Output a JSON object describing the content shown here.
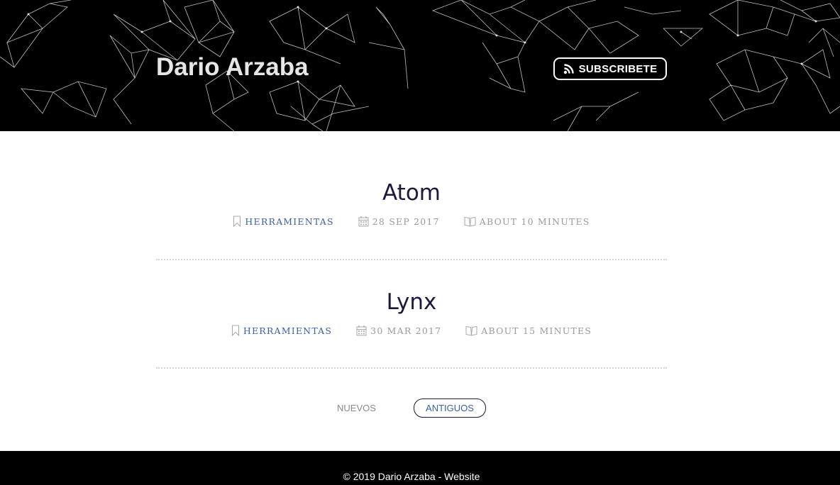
{
  "header": {
    "site_title": "Dario Arzaba",
    "subscribe_label": "SUBSCRIBETE"
  },
  "posts": [
    {
      "title": "Atom",
      "tag": "HERRAMIENTAS",
      "date": "28 SEP 2017",
      "reading_time": "ABOUT 10 MINUTES"
    },
    {
      "title": "Lynx",
      "tag": "HERRAMIENTAS",
      "date": "30 MAR 2017",
      "reading_time": "ABOUT 15 MINUTES"
    }
  ],
  "pagination": {
    "newer_label": "NUEVOS",
    "older_label": "ANTIGUOS"
  },
  "footer": {
    "copyright": "© 2019 Dario Arzaba - ",
    "link_label": "Website"
  },
  "icons": {
    "subscribe": "rss-icon",
    "tag": "bookmark-icon",
    "date": "calendar-icon",
    "reading_time": "book-icon"
  },
  "colors": {
    "header_bg": "#000000",
    "post_title": "#1b1a3e",
    "link_accent": "#3a5ea8",
    "meta_text": "#9a9a9a"
  }
}
